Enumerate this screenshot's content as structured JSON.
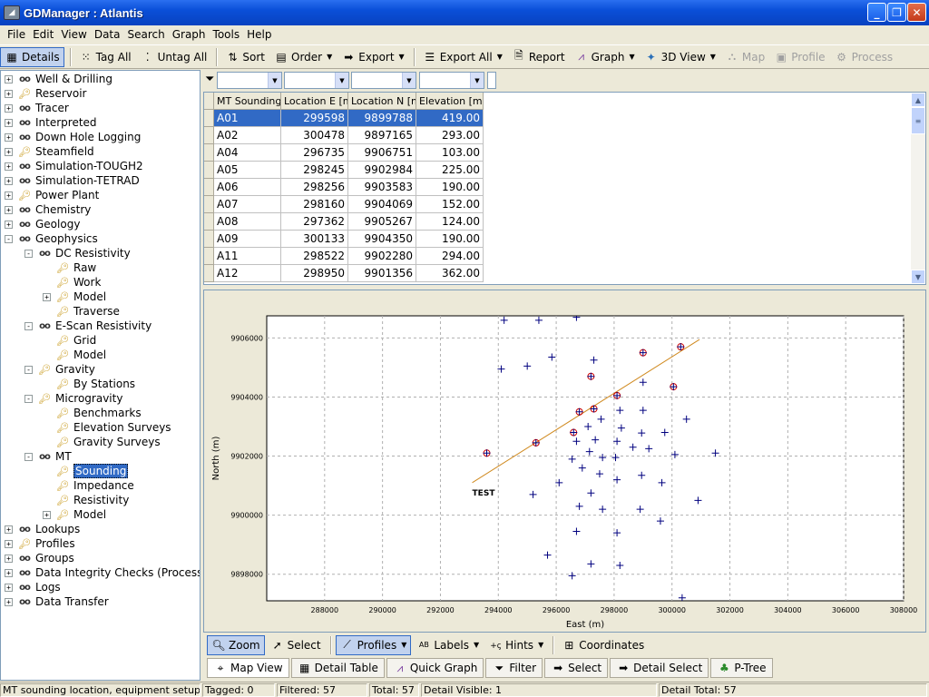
{
  "window": {
    "title": "GDManager : Atlantis"
  },
  "menu": [
    "File",
    "Edit",
    "View",
    "Data",
    "Search",
    "Graph",
    "Tools",
    "Help"
  ],
  "toolbar": {
    "details": "Details",
    "tag_all": "Tag All",
    "untag_all": "Untag All",
    "sort": "Sort",
    "order": "Order",
    "export": "Export",
    "export_all": "Export All",
    "report": "Report",
    "graph": "Graph",
    "view3d": "3D View",
    "map": "Map",
    "profile": "Profile",
    "process": "Process"
  },
  "tree": [
    {
      "label": "Well & Drilling",
      "icon": "glasses-icon",
      "level": 0,
      "expander": "+"
    },
    {
      "label": "Reservoir",
      "icon": "key-icon",
      "level": 0,
      "expander": "+"
    },
    {
      "label": "Tracer",
      "icon": "glasses-icon",
      "level": 0,
      "expander": "+"
    },
    {
      "label": "Interpreted",
      "icon": "glasses-icon",
      "level": 0,
      "expander": "+"
    },
    {
      "label": "Down Hole Logging",
      "icon": "glasses-icon",
      "level": 0,
      "expander": "+"
    },
    {
      "label": "Steamfield",
      "icon": "key-icon",
      "level": 0,
      "expander": "+"
    },
    {
      "label": "Simulation-TOUGH2",
      "icon": "glasses-icon",
      "level": 0,
      "expander": "+"
    },
    {
      "label": "Simulation-TETRAD",
      "icon": "glasses-icon",
      "level": 0,
      "expander": "+"
    },
    {
      "label": "Power Plant",
      "icon": "key-icon",
      "level": 0,
      "expander": "+"
    },
    {
      "label": "Chemistry",
      "icon": "glasses-icon",
      "level": 0,
      "expander": "+"
    },
    {
      "label": "Geology",
      "icon": "glasses-icon",
      "level": 0,
      "expander": "+"
    },
    {
      "label": "Geophysics",
      "icon": "glasses-icon",
      "level": 0,
      "expander": "-"
    },
    {
      "label": "DC Resistivity",
      "icon": "glasses-icon",
      "level": 1,
      "expander": "-"
    },
    {
      "label": "Raw",
      "icon": "key-icon",
      "level": 2,
      "expander": ""
    },
    {
      "label": "Work",
      "icon": "key-icon",
      "level": 2,
      "expander": ""
    },
    {
      "label": "Model",
      "icon": "key-icon",
      "level": 2,
      "expander": "+"
    },
    {
      "label": "Traverse",
      "icon": "key-icon",
      "level": 2,
      "expander": ""
    },
    {
      "label": "E-Scan Resistivity",
      "icon": "glasses-icon",
      "level": 1,
      "expander": "-"
    },
    {
      "label": "Grid",
      "icon": "key-icon",
      "level": 2,
      "expander": ""
    },
    {
      "label": "Model",
      "icon": "key-icon",
      "level": 2,
      "expander": ""
    },
    {
      "label": "Gravity",
      "icon": "key-icon",
      "level": 1,
      "expander": "-"
    },
    {
      "label": "By Stations",
      "icon": "key-icon",
      "level": 2,
      "expander": ""
    },
    {
      "label": "Microgravity",
      "icon": "key-icon",
      "level": 1,
      "expander": "-"
    },
    {
      "label": "Benchmarks",
      "icon": "key-icon",
      "level": 2,
      "expander": ""
    },
    {
      "label": "Elevation Surveys",
      "icon": "key-icon",
      "level": 2,
      "expander": ""
    },
    {
      "label": "Gravity Surveys",
      "icon": "key-icon",
      "level": 2,
      "expander": ""
    },
    {
      "label": "MT",
      "icon": "glasses-icon",
      "level": 1,
      "expander": "-"
    },
    {
      "label": "Sounding",
      "icon": "key-icon",
      "level": 2,
      "expander": "",
      "selected": true
    },
    {
      "label": "Impedance",
      "icon": "key-icon",
      "level": 2,
      "expander": ""
    },
    {
      "label": "Resistivity",
      "icon": "key-icon",
      "level": 2,
      "expander": ""
    },
    {
      "label": "Model",
      "icon": "key-icon",
      "level": 2,
      "expander": "+"
    },
    {
      "label": "Lookups",
      "icon": "glasses-icon",
      "level": 0,
      "expander": "+"
    },
    {
      "label": "Profiles",
      "icon": "key-icon",
      "level": 0,
      "expander": "+"
    },
    {
      "label": "Groups",
      "icon": "glasses-icon",
      "level": 0,
      "expander": "+"
    },
    {
      "label": "Data Integrity Checks (Process)",
      "icon": "glasses-icon",
      "level": 0,
      "expander": "+"
    },
    {
      "label": "Logs",
      "icon": "glasses-icon",
      "level": 0,
      "expander": "+"
    },
    {
      "label": "Data Transfer",
      "icon": "glasses-icon",
      "level": 0,
      "expander": "+"
    }
  ],
  "table": {
    "headers": [
      "MT Sounding",
      "Location E [m]",
      "Location N [m]",
      "Elevation [m]"
    ],
    "rows": [
      [
        "A01",
        "299598",
        "9899788",
        "419.00"
      ],
      [
        "A02",
        "300478",
        "9897165",
        "293.00"
      ],
      [
        "A04",
        "296735",
        "9906751",
        "103.00"
      ],
      [
        "A05",
        "298245",
        "9902984",
        "225.00"
      ],
      [
        "A06",
        "298256",
        "9903583",
        "190.00"
      ],
      [
        "A07",
        "298160",
        "9904069",
        "152.00"
      ],
      [
        "A08",
        "297362",
        "9905267",
        "124.00"
      ],
      [
        "A09",
        "300133",
        "9904350",
        "190.00"
      ],
      [
        "A11",
        "298522",
        "9902280",
        "294.00"
      ],
      [
        "A12",
        "298950",
        "9901356",
        "362.00"
      ]
    ]
  },
  "chart_data": {
    "type": "scatter",
    "xlabel": "East (m)",
    "ylabel": "North (m)",
    "xlim": [
      286000,
      308000
    ],
    "ylim": [
      9897100,
      9906750
    ],
    "xticks": [
      288000,
      290000,
      292000,
      294000,
      296000,
      298000,
      300000,
      302000,
      304000,
      306000,
      308000
    ],
    "yticks": [
      9898000,
      9900000,
      9902000,
      9904000,
      9906000
    ],
    "grid": true,
    "profile_line": {
      "name": "TEST",
      "x": [
        293100,
        300950
      ],
      "y": [
        9901100,
        9905950
      ]
    },
    "points": [
      [
        294200,
        9906600
      ],
      [
        295400,
        9906600
      ],
      [
        296700,
        9906700
      ],
      [
        299000,
        9905500
      ],
      [
        300300,
        9905700
      ],
      [
        294100,
        9904950
      ],
      [
        295000,
        9905050
      ],
      [
        295850,
        9905350
      ],
      [
        297300,
        9905250
      ],
      [
        297200,
        9904700
      ],
      [
        298100,
        9904050
      ],
      [
        299000,
        9904500
      ],
      [
        300050,
        9904350
      ],
      [
        296800,
        9903500
      ],
      [
        297300,
        9903600
      ],
      [
        298200,
        9903550
      ],
      [
        299000,
        9903550
      ],
      [
        297550,
        9903250
      ],
      [
        300500,
        9903250
      ],
      [
        296600,
        9902800
      ],
      [
        297100,
        9903000
      ],
      [
        298250,
        9902950
      ],
      [
        298950,
        9902780
      ],
      [
        299750,
        9902800
      ],
      [
        293600,
        9902100
      ],
      [
        295300,
        9902450
      ],
      [
        296700,
        9902500
      ],
      [
        297350,
        9902550
      ],
      [
        298100,
        9902500
      ],
      [
        297150,
        9902150
      ],
      [
        298650,
        9902300
      ],
      [
        299200,
        9902250
      ],
      [
        296550,
        9901900
      ],
      [
        297600,
        9901950
      ],
      [
        298050,
        9901950
      ],
      [
        300100,
        9902050
      ],
      [
        301500,
        9902100
      ],
      [
        296900,
        9901600
      ],
      [
        297500,
        9901400
      ],
      [
        298100,
        9901200
      ],
      [
        298950,
        9901350
      ],
      [
        296100,
        9901100
      ],
      [
        299650,
        9901100
      ],
      [
        297200,
        9900750
      ],
      [
        295200,
        9900700
      ],
      [
        296800,
        9900300
      ],
      [
        297600,
        9900200
      ],
      [
        298900,
        9900200
      ],
      [
        300900,
        9900500
      ],
      [
        299600,
        9899800
      ],
      [
        296700,
        9899450
      ],
      [
        298100,
        9899400
      ],
      [
        295700,
        9898650
      ],
      [
        297200,
        9898350
      ],
      [
        298200,
        9898300
      ],
      [
        296550,
        9897950
      ],
      [
        300350,
        9897200
      ]
    ],
    "highlighted": [
      [
        293600,
        9902100
      ],
      [
        295300,
        9902450
      ],
      [
        296600,
        9902800
      ],
      [
        296800,
        9903500
      ],
      [
        297300,
        9903600
      ],
      [
        298100,
        9904050
      ],
      [
        300050,
        9904350
      ],
      [
        299000,
        9905500
      ],
      [
        300300,
        9905700
      ],
      [
        297200,
        9904700
      ]
    ],
    "colors": {
      "point": "#00007f",
      "highlight": "#cc0000",
      "line": "#d08a20"
    }
  },
  "plot_toolbar": {
    "zoom": "Zoom",
    "select": "Select",
    "profiles": "Profiles",
    "labels": "Labels",
    "hints": "Hints",
    "coordinates": "Coordinates"
  },
  "view_tabs": [
    "Map View",
    "Detail Table",
    "Quick Graph",
    "Filter",
    "Select",
    "Detail Select",
    "P-Tree"
  ],
  "status": {
    "message": "MT sounding location, equipment setup and o",
    "tagged": "Tagged: 0",
    "filtered": "Filtered: 57",
    "total": "Total: 57",
    "detail_visible": "Detail Visible: 1",
    "detail_total": "Detail Total: 57"
  }
}
